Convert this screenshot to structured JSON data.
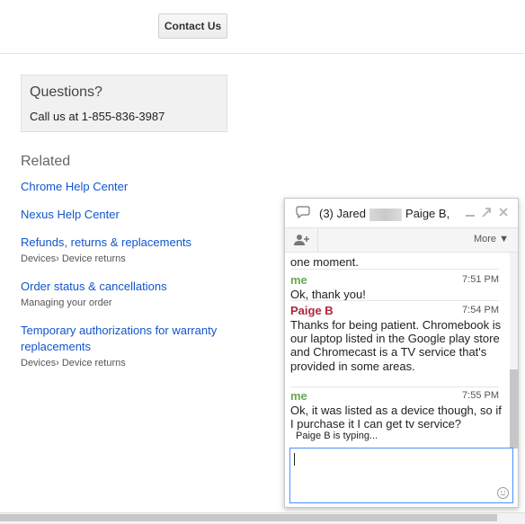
{
  "header": {
    "contact_label": "Contact Us"
  },
  "questions": {
    "title": "Questions?",
    "phone_text": "Call us at 1-855-836-3987"
  },
  "related": {
    "title": "Related",
    "items": [
      {
        "label": "Chrome Help Center",
        "sub": ""
      },
      {
        "label": "Nexus Help Center",
        "sub": ""
      },
      {
        "label": "Refunds, returns & replacements",
        "sub": "Devices› Device returns"
      },
      {
        "label": "Order status & cancellations",
        "sub": "Managing your order"
      },
      {
        "label": "Temporary authorizations for warranty replacements",
        "sub": "Devices› Device returns"
      }
    ]
  },
  "chat": {
    "title_prefix": "(3) Jared",
    "title_suffix": "Paige B,",
    "more_label": "More ▼",
    "partial_text": "one moment.",
    "messages": [
      {
        "sender": "me",
        "time": "7:51 PM",
        "text": "Ok, thank you!"
      },
      {
        "sender": "Paige B",
        "time": "7:54 PM",
        "text": "Thanks for being patient. Chromebook is our laptop listed in the Google play store and Chromecast is a TV service that's provided in some areas."
      },
      {
        "sender": "me",
        "time": "7:55 PM",
        "text": "Ok, it was listed as a device though, so if I purchase it I can get tv service?"
      }
    ],
    "typing_text": "Paige B is typing...",
    "colors": {
      "me": "#6aa84f",
      "agent": "#b0243a",
      "focus": "#4d90fe"
    },
    "icons": [
      "chat-bubble-icon",
      "minimize-icon",
      "popout-icon",
      "close-icon",
      "add-person-icon",
      "smiley-icon"
    ]
  }
}
